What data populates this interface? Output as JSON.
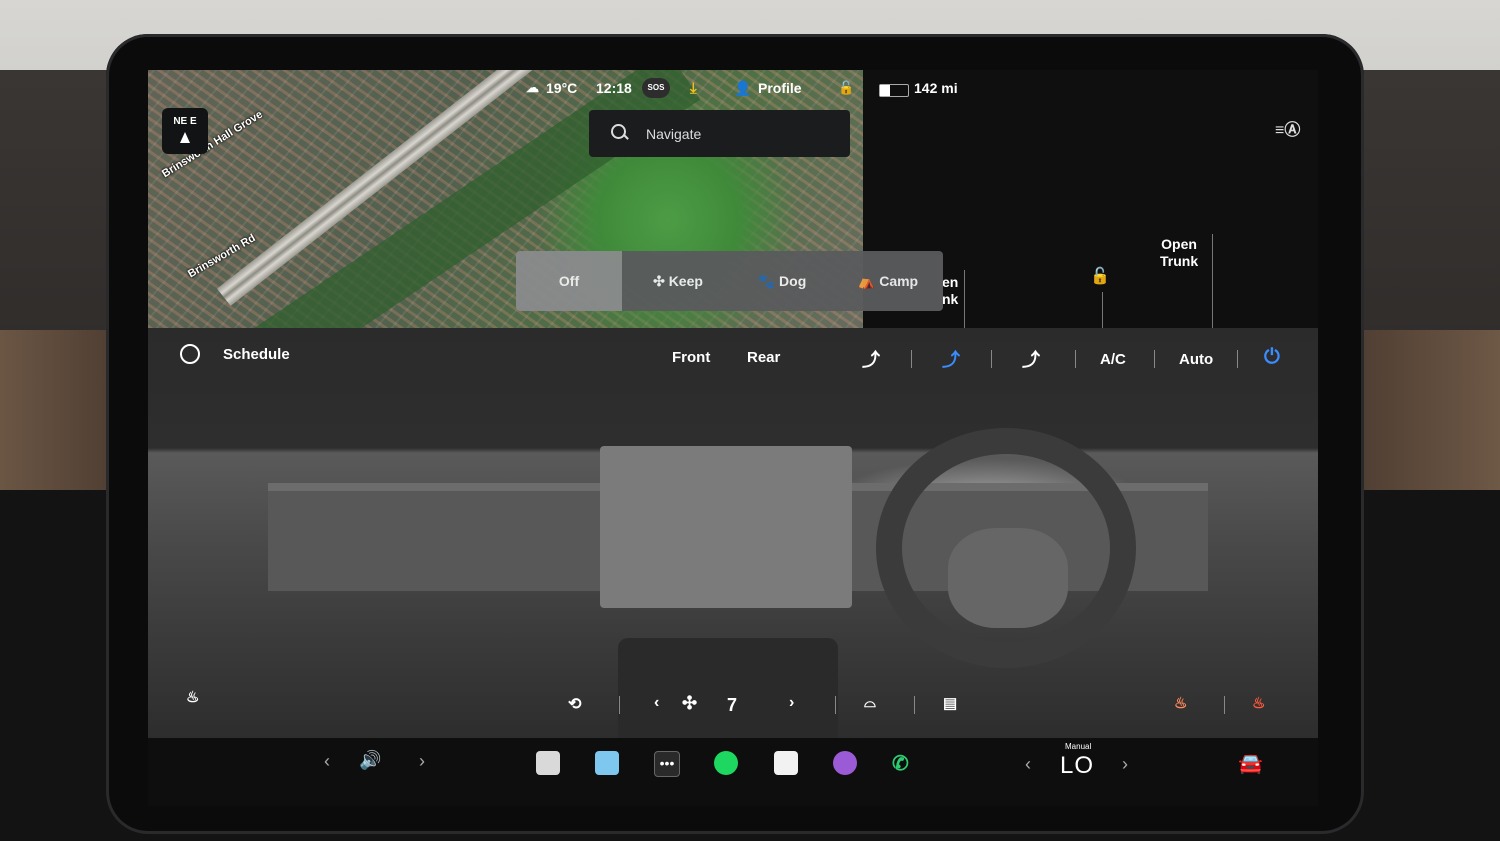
{
  "status_bar": {
    "temperature": "19°C",
    "time": "12:18",
    "sos": "SOS",
    "profile": "Profile",
    "range": "142 mi"
  },
  "map": {
    "compass": "NE  E",
    "labels": [
      "Brinsworth Hall Grove",
      "Brinsworth Rd"
    ],
    "navigate_placeholder": "Navigate"
  },
  "vehicle": {
    "open_frunk": "en\nnk",
    "open_trunk": "Open\nTrunk"
  },
  "modes": {
    "items": [
      "Off",
      "Keep",
      "Dog",
      "Camp"
    ],
    "selected": "Off"
  },
  "climate": {
    "schedule": "Schedule",
    "front": "Front",
    "rear": "Rear",
    "ac": "A/C",
    "auto": "Auto",
    "fan_speed": "7",
    "accent_color": "#3b8cff"
  },
  "bottom_bar": {
    "temp_mode": "Manual",
    "temp_value": "LO"
  }
}
